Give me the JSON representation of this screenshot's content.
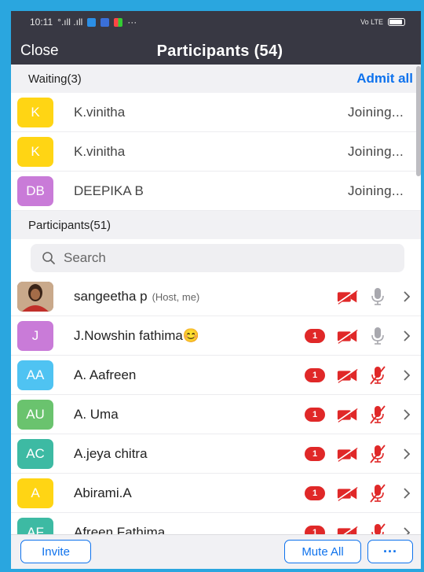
{
  "status_bar": {
    "time": "10:11",
    "signal_text": "°.ıll .ıll",
    "more": "···",
    "volte": "Vo LTE"
  },
  "header": {
    "close_label": "Close",
    "title": "Participants (54)"
  },
  "waiting": {
    "label": "Waiting(3)",
    "admit_all_label": "Admit all",
    "items": [
      {
        "initials": "K",
        "name": "K.vinitha",
        "status": "Joining...",
        "color": "#ffd514"
      },
      {
        "initials": "K",
        "name": "K.vinitha",
        "status": "Joining...",
        "color": "#ffd514"
      },
      {
        "initials": "DB",
        "name": "DEEPIKA B",
        "status": "Joining...",
        "color": "#c97bd8"
      }
    ]
  },
  "participants": {
    "label": "Participants(51)",
    "search_placeholder": "Search",
    "items": [
      {
        "initials": "",
        "photo": true,
        "name": "sangeetha p",
        "sub": "(Host, me)",
        "badge": "",
        "mic_muted": false
      },
      {
        "initials": "J",
        "name": "J.Nowshin fathima😊",
        "sub": "",
        "badge": "1",
        "mic_muted": false,
        "color": "#c97bd8"
      },
      {
        "initials": "AA",
        "name": "A. Aafreen",
        "sub": "",
        "badge": "1",
        "mic_muted": true,
        "color": "#4fc3f2"
      },
      {
        "initials": "AU",
        "name": "A. Uma",
        "sub": "",
        "badge": "1",
        "mic_muted": true,
        "color": "#6ac36e"
      },
      {
        "initials": "AC",
        "name": "A.jeya chitra",
        "sub": "",
        "badge": "1",
        "mic_muted": true,
        "color": "#3dbaa3"
      },
      {
        "initials": "A",
        "name": "Abirami.A",
        "sub": "",
        "badge": "1",
        "mic_muted": true,
        "color": "#ffd514"
      },
      {
        "initials": "AF",
        "name": "Afreen Fathima",
        "sub": "",
        "badge": "1",
        "mic_muted": true,
        "color": "#3dbaa3"
      }
    ]
  },
  "bottom": {
    "invite_label": "Invite",
    "mute_all_label": "Mute All",
    "more_label": "···"
  },
  "colors": {
    "accent": "#0e72ed",
    "header_bg": "#383843",
    "badge_red": "#e02828",
    "video_off_red": "#e02828"
  }
}
